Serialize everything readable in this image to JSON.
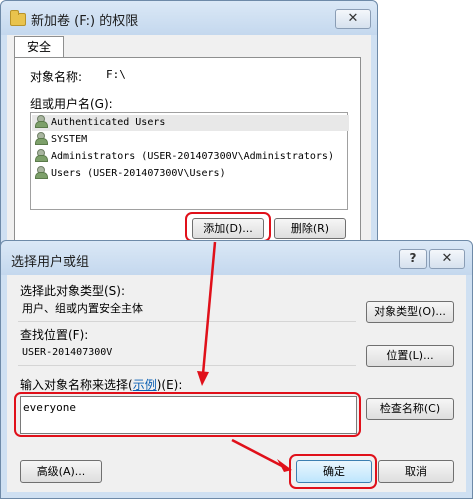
{
  "perm_window": {
    "title": "新加卷 (F:) 的权限",
    "close": "✕",
    "tab": "安全",
    "object_name_label": "对象名称:",
    "object_name_value": "F:\\",
    "group_label": "组或用户名(G):",
    "users": [
      "Authenticated Users",
      "SYSTEM",
      "Administrators (USER-201407300V\\Administrators)",
      "Users (USER-201407300V\\Users)"
    ],
    "add_button": "添加(D)...",
    "remove_button": "删除(R)"
  },
  "select_dialog": {
    "title": "选择用户或组",
    "help": "?",
    "close": "✕",
    "object_type_label": "选择此对象类型(S):",
    "object_type_value": "用户、组或内置安全主体",
    "object_type_button": "对象类型(O)...",
    "location_label": "查找位置(F):",
    "location_value": "USER-201407300V",
    "location_button": "位置(L)...",
    "enter_label_pre": "输入对象名称来选择(",
    "enter_label_link": "示例",
    "enter_label_post": ")(E):",
    "entered_name": "everyone",
    "check_names_button": "检查名称(C)",
    "advanced_button": "高级(A)...",
    "ok_button": "确定",
    "cancel_button": "取消"
  },
  "colors": {
    "annotation_red": "#e0101a"
  }
}
